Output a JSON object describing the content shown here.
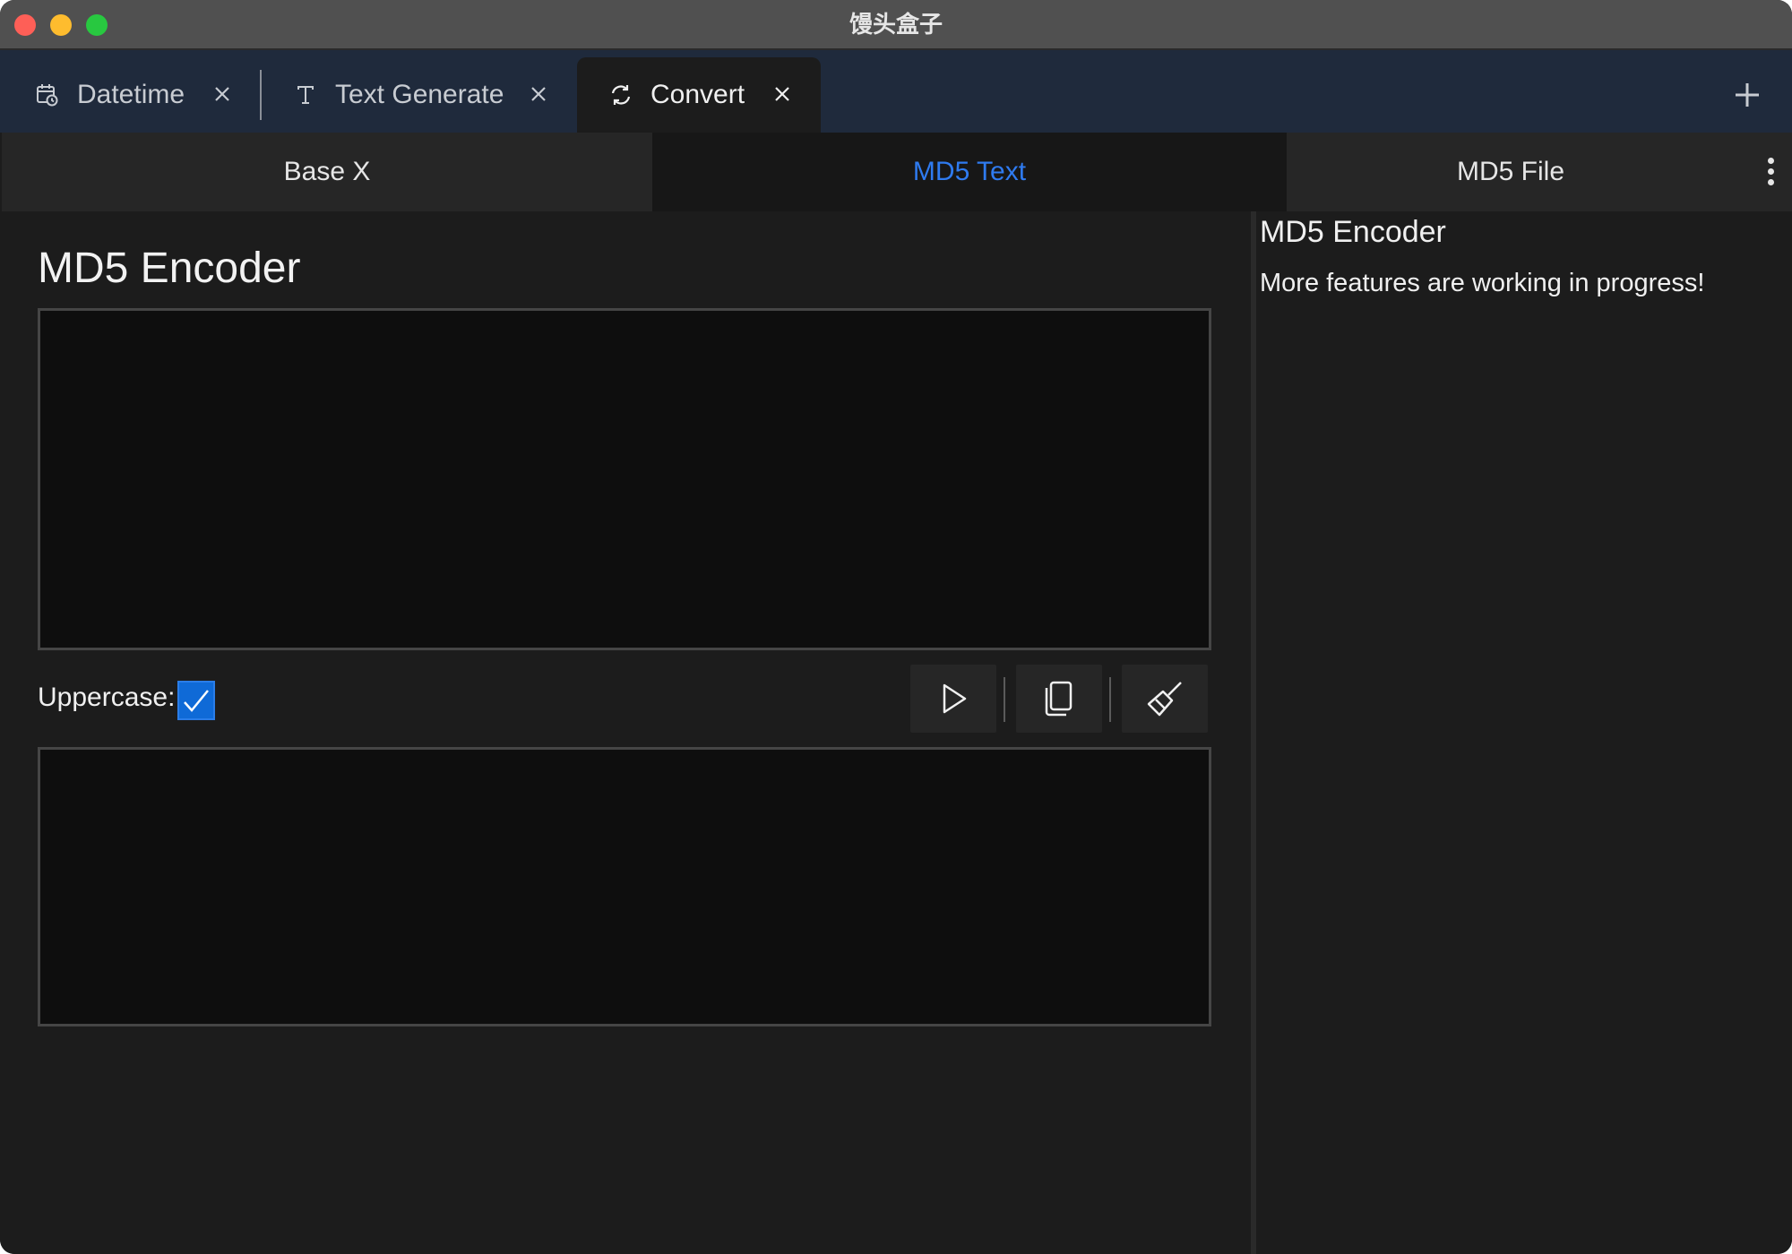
{
  "window": {
    "title": "馒头盒子"
  },
  "tabs": [
    {
      "label": "Datetime",
      "icon": "calendar-clock-icon"
    },
    {
      "label": "Text Generate",
      "icon": "text-t-icon"
    },
    {
      "label": "Convert",
      "icon": "refresh-icon",
      "active": true
    }
  ],
  "subtabs": [
    {
      "label": "Base X"
    },
    {
      "label": "MD5 Text",
      "active": true
    },
    {
      "label": "MD5 File"
    }
  ],
  "main": {
    "title": "MD5 Encoder",
    "input_value": "",
    "output_value": "",
    "uppercase_label": "Uppercase:",
    "uppercase_checked": true,
    "actions": [
      {
        "name": "run",
        "icon": "play-icon"
      },
      {
        "name": "copy",
        "icon": "copy-icon"
      },
      {
        "name": "clear",
        "icon": "broom-icon"
      }
    ]
  },
  "info_panel": {
    "title": "MD5 Encoder",
    "description": "More features are working in progress!"
  },
  "colors": {
    "accent": "#2f7bf0",
    "checkbox": "#0f6ad7",
    "tabbar": "#1f2a3c",
    "background": "#1c1c1c",
    "textarea": "#0e0e0e"
  }
}
